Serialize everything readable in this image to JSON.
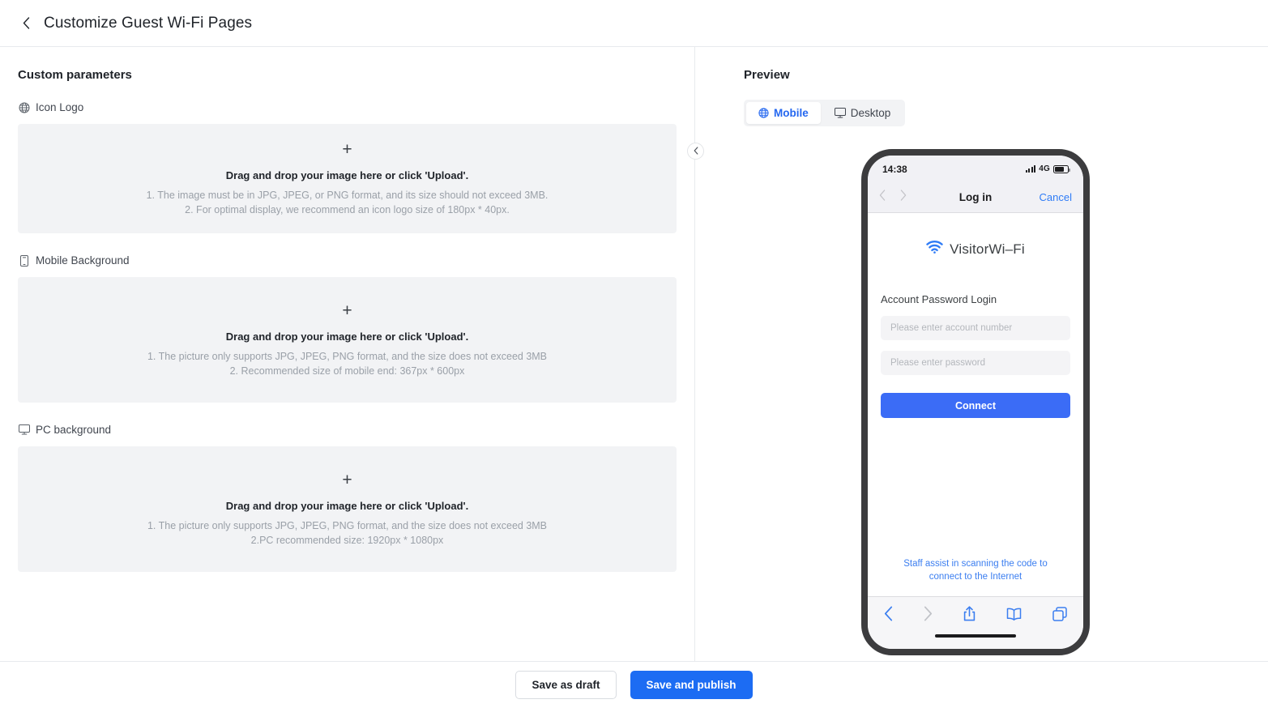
{
  "header": {
    "title": "Customize Guest Wi-Fi Pages",
    "back_icon": "chevron-left-icon"
  },
  "left": {
    "section_title": "Custom parameters",
    "fields": [
      {
        "icon": "globe-icon",
        "label": "Icon Logo",
        "plus": "+",
        "headline": "Drag and drop your image here or click 'Upload'.",
        "line1": "1. The image must be in JPG, JPEG, or PNG format, and its size should not exceed 3MB.",
        "line2": "2. For optimal display, we recommend an icon logo size of 180px * 40px."
      },
      {
        "icon": "mobile-icon",
        "label": "Mobile Background",
        "plus": "+",
        "headline": "Drag and drop your image here or click 'Upload'.",
        "line1": "1. The picture only supports JPG, JPEG, PNG format, and the size does not exceed 3MB",
        "line2": "2. Recommended size of mobile end: 367px * 600px"
      },
      {
        "icon": "monitor-icon",
        "label": "PC background",
        "plus": "+",
        "headline": "Drag and drop your image here or click 'Upload'.",
        "line1": "1. The picture only supports JPG, JPEG, PNG format, and the size does not exceed 3MB",
        "line2": "2.PC recommended size: 1920px * 1080px"
      }
    ]
  },
  "divider": {
    "collapse_icon": "chevron-left-icon"
  },
  "preview": {
    "title": "Preview",
    "tabs": [
      {
        "label": "Mobile",
        "icon": "globe-icon",
        "active": true
      },
      {
        "label": "Desktop",
        "icon": "monitor-icon",
        "active": false
      }
    ],
    "phone": {
      "status": {
        "time": "14:38",
        "network": "4G",
        "signal_icon": "signal-bars-icon",
        "battery_icon": "battery-icon"
      },
      "nav": {
        "back_icon": "chevron-left-icon",
        "forward_icon": "chevron-right-icon",
        "title": "Log in",
        "cancel": "Cancel"
      },
      "brand": {
        "icon": "wifi-icon",
        "name": "VisitorWi–Fi"
      },
      "login_heading": "Account Password Login",
      "account_placeholder": "Please enter account number",
      "password_placeholder": "Please enter password",
      "connect_label": "Connect",
      "assist_text": "Staff assist in scanning the code to connect to the Internet",
      "toolbar_icons": [
        "chevron-left-icon",
        "chevron-right-icon",
        "share-icon",
        "book-icon",
        "tabs-icon"
      ]
    }
  },
  "footer": {
    "draft_label": "Save as draft",
    "publish_label": "Save and publish"
  },
  "colors": {
    "accent_blue": "#1c6cf3",
    "tab_blue": "#2467f0",
    "connect_blue": "#3b6cf6",
    "ios_blue": "#2f7cf6",
    "dropzone_bg": "#f2f3f5",
    "phone_frame": "#3c3c3e",
    "muted_text": "#9aa0a8"
  }
}
